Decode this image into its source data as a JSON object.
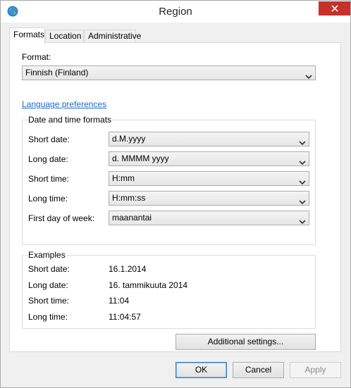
{
  "window": {
    "title": "Region"
  },
  "tabs": [
    {
      "label": "Formats",
      "active": true
    },
    {
      "label": "Location",
      "active": false
    },
    {
      "label": "Administrative",
      "active": false
    }
  ],
  "formats": {
    "format_label": "Format:",
    "format_value": "Finnish (Finland)",
    "language_link": "Language preferences",
    "date_time_group": {
      "legend": "Date and time formats",
      "rows": [
        {
          "label": "Short date:",
          "value": "d.M.yyyy"
        },
        {
          "label": "Long date:",
          "value": "d. MMMM yyyy"
        },
        {
          "label": "Short time:",
          "value": "H:mm"
        },
        {
          "label": "Long time:",
          "value": "H:mm:ss"
        },
        {
          "label": "First day of week:",
          "value": "maanantai"
        }
      ]
    },
    "examples_group": {
      "legend": "Examples",
      "rows": [
        {
          "label": "Short date:",
          "value": "16.1.2014"
        },
        {
          "label": "Long date:",
          "value": "16. tammikuuta 2014"
        },
        {
          "label": "Short time:",
          "value": "11:04"
        },
        {
          "label": "Long time:",
          "value": "11:04:57"
        }
      ]
    },
    "additional_settings_label": "Additional settings..."
  },
  "footer": {
    "ok_label": "OK",
    "cancel_label": "Cancel",
    "apply_label": "Apply"
  },
  "icons": {
    "app": "globe-icon",
    "close": "close-icon",
    "dropdown": "chevron-down-icon"
  },
  "colors": {
    "close_button": "#c7312b",
    "link": "#1b6ac9",
    "default_button_border": "#3c7fb1"
  }
}
